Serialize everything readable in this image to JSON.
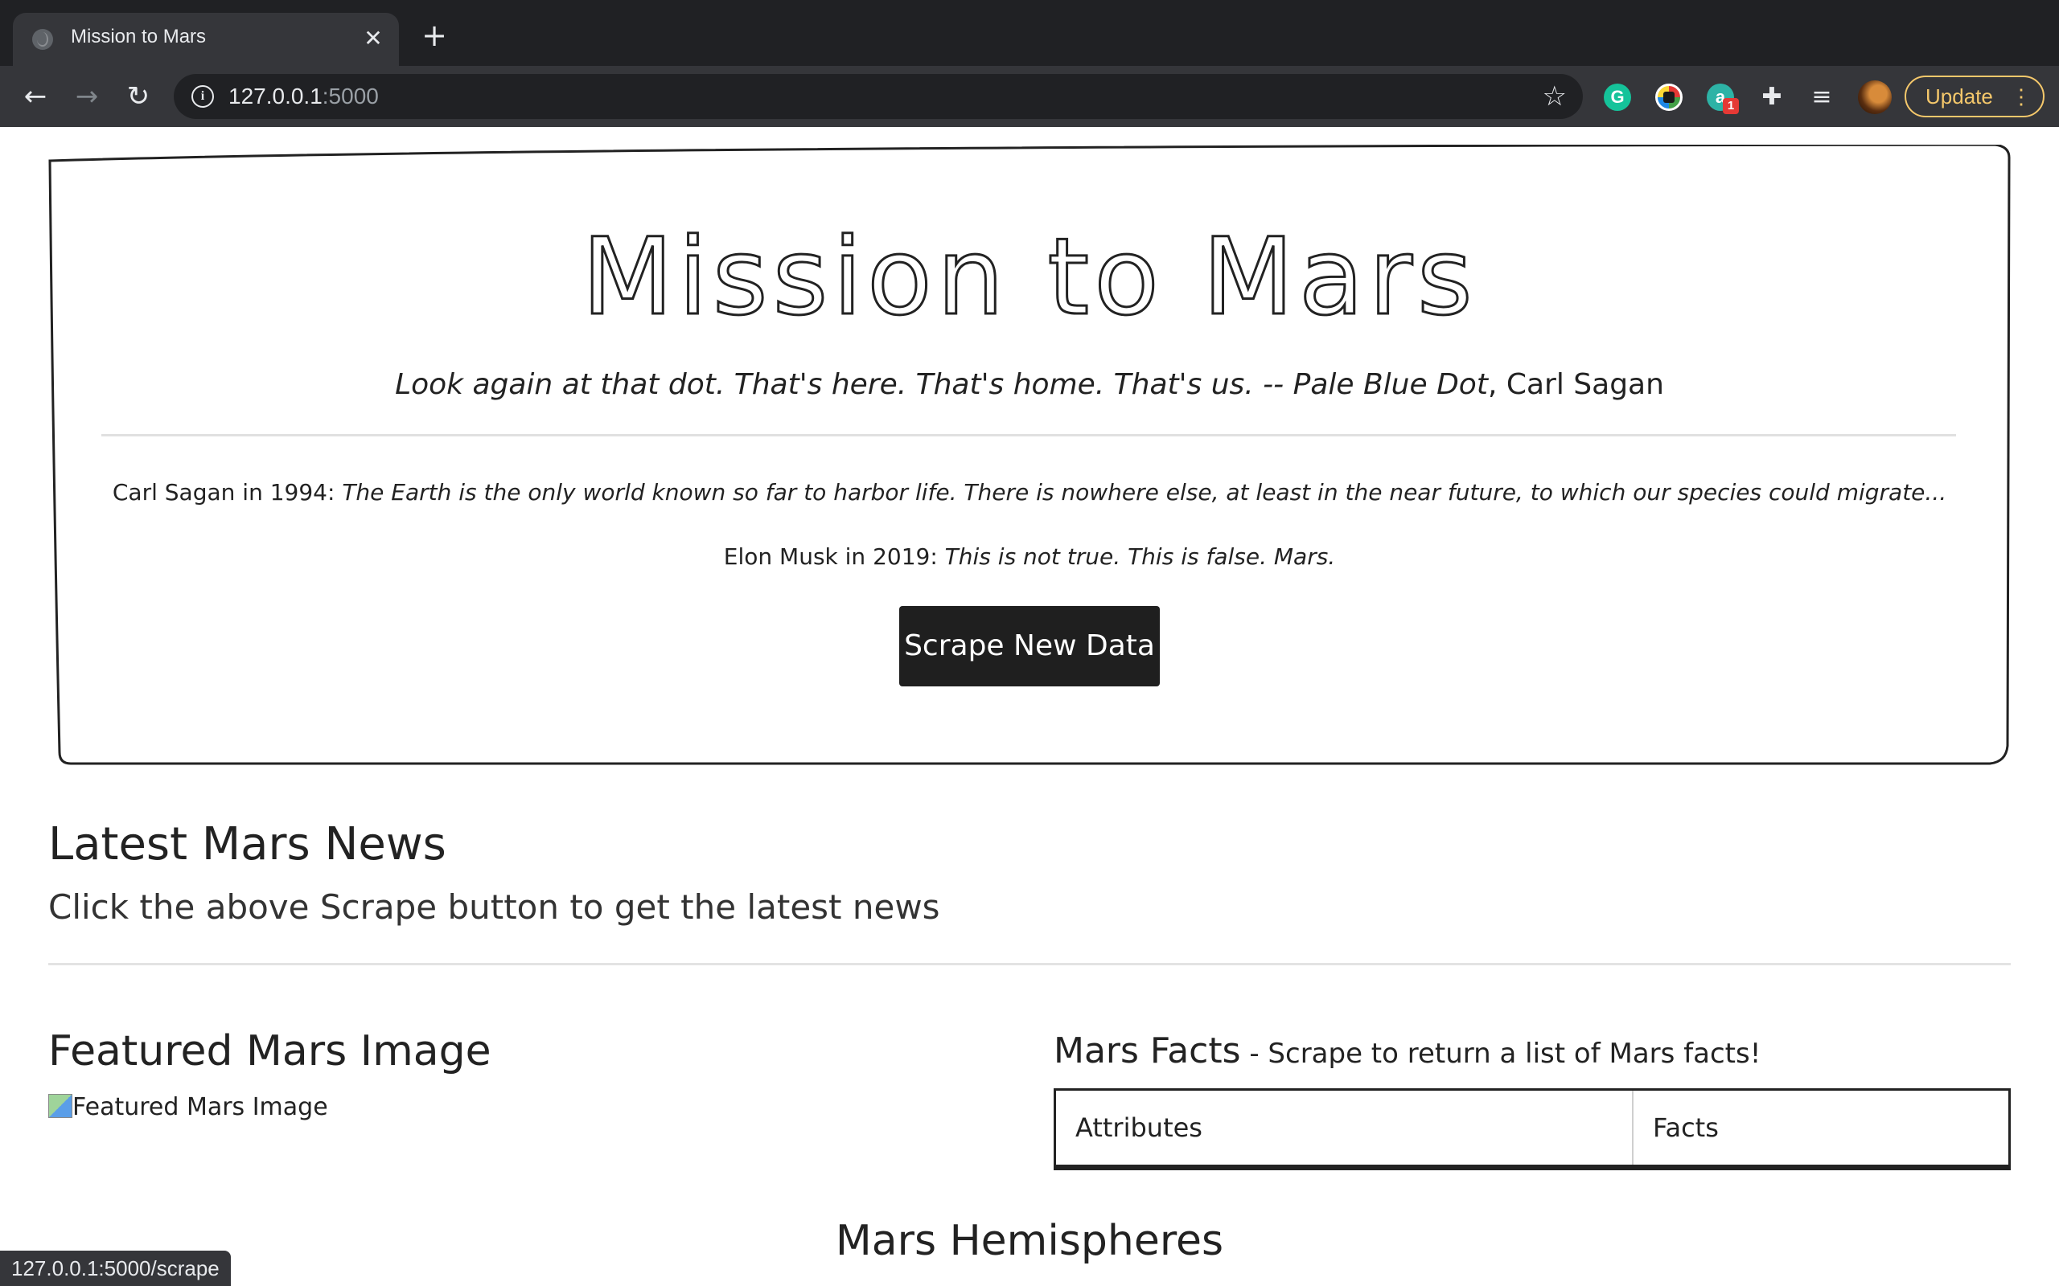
{
  "browser": {
    "tab_title": "Mission to Mars",
    "tab_close": "✕",
    "new_tab": "+",
    "back": "←",
    "forward": "→",
    "reload": "↻",
    "info": "i",
    "url_host": "127.0.0.1",
    "url_port": ":5000",
    "bookmark": "☆",
    "extensions": {
      "grammarly": "G",
      "badge_ext_letter": "a",
      "badge_count": "1",
      "puzzle": "✚",
      "media": "≡"
    },
    "update_label": "Update",
    "update_menu": "⋮",
    "status_url": "127.0.0.1:5000/scrape"
  },
  "jumbotron": {
    "title": "Mission to Mars",
    "quote_italic": "Look again at that dot. That's here. That's home. That's us. -- Pale Blue Dot",
    "quote_author": ", Carl Sagan",
    "line1_prefix": "Carl Sagan in 1994: ",
    "line1_italic": "The Earth is the only world known so far to harbor life. There is nowhere else, at least in the near future, to which our species could migrate...",
    "line2_prefix": "Elon Musk in 2019: ",
    "line2_italic": "This is not true. This is false. Mars.",
    "button_label": "Scrape New Data"
  },
  "news": {
    "title": "Latest Mars News",
    "subtitle": "Click the above Scrape button to get the latest news"
  },
  "featured": {
    "title": "Featured Mars Image",
    "img_alt": "Featured Mars Image"
  },
  "facts": {
    "title": "Mars Facts",
    "subtitle": " - Scrape to return a list of Mars facts!",
    "columns": [
      "Attributes",
      "Facts"
    ]
  },
  "hemispheres": {
    "title": "Mars Hemispheres"
  }
}
